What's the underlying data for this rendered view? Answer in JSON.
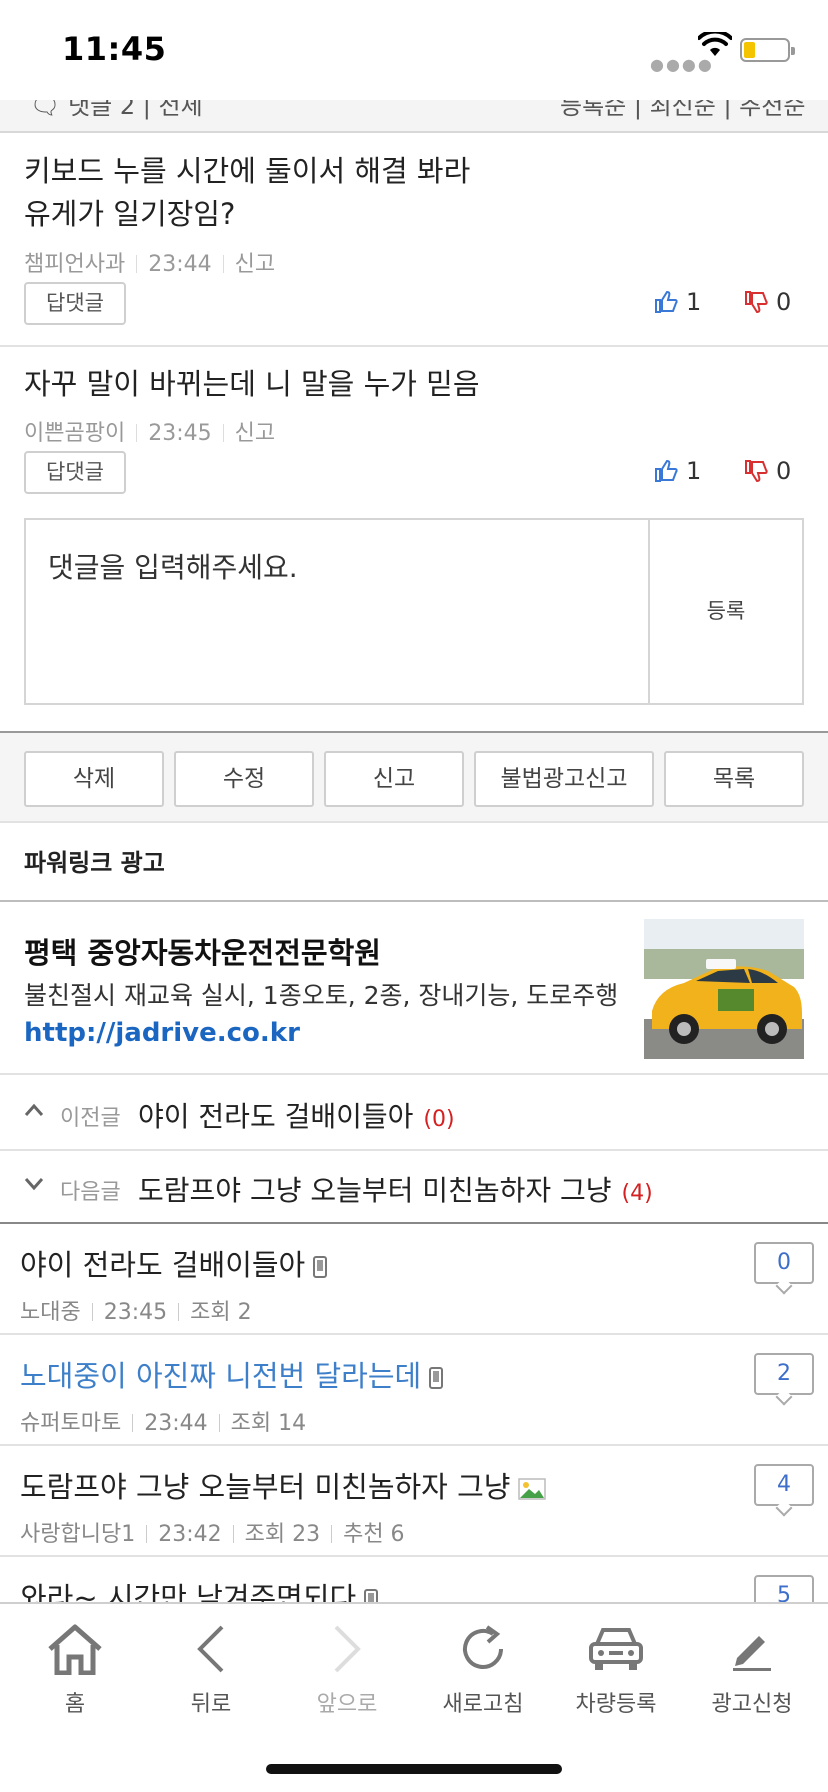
{
  "status_bar": {
    "time": "11:45"
  },
  "comments": [
    {
      "text_line1": "키보드 누를 시간에 둘이서 해결 봐라",
      "text_line2": "유게가 일기장임?",
      "author": "챔피언사과",
      "time": "23:44",
      "report": "신고",
      "reply_label": "답댓글",
      "likes": "1",
      "dislikes": "0"
    },
    {
      "text_line1": "자꾸 말이 바뀌는데 니 말을 누가 믿음",
      "author": "이쁜곰팡이",
      "time": "23:45",
      "report": "신고",
      "reply_label": "답댓글",
      "likes": "1",
      "dislikes": "0"
    }
  ],
  "comment_input": {
    "placeholder": "댓글을 입력해주세요.",
    "submit_label": "등록"
  },
  "actions": {
    "delete": "삭제",
    "edit": "수정",
    "report": "신고",
    "ad_report": "불법광고신고",
    "list": "목록"
  },
  "powerlink": {
    "heading": "파워링크 광고",
    "title": "평택 중앙자동차운전전문학원",
    "description": "불친절시 재교육 실시, 1종오토, 2종, 장내기능, 도로주행",
    "url": "http://jadrive.co.kr"
  },
  "prev_post": {
    "label": "이전글",
    "title": "야이 전라도 걸배이들아",
    "count": "(0)"
  },
  "next_post": {
    "label": "다음글",
    "title": "도람프야 그냥 오늘부터 미친놈하자 그냥",
    "count": "(4)"
  },
  "posts": [
    {
      "title": "야이 전라도 걸배이들아",
      "author": "노대중",
      "time": "23:45",
      "views": "조회 2",
      "comments": "0"
    },
    {
      "title": "노대중이 아진짜 니전번 달라는데",
      "author": "슈퍼토마토",
      "time": "23:44",
      "views": "조회 14",
      "comments": "2"
    },
    {
      "title": "도람프야 그냥 오늘부터 미친놈하자 그냥",
      "author": "사랑합니당1",
      "time": "23:42",
      "views": "조회 23",
      "recommend": "추천 6",
      "comments": "4"
    },
    {
      "title": "와라~ 시간만 남겨주면되다",
      "comments": "5"
    }
  ],
  "toolbar": {
    "home": "홈",
    "back": "뒤로",
    "forward": "앞으로",
    "refresh": "새로고침",
    "car": "차량등록",
    "ad": "광고신청"
  },
  "colors": {
    "link_blue": "#1a66c1",
    "title_blue": "#3d7fc9",
    "count_red": "#d42020",
    "like_blue": "#3a78d8",
    "dislike_red": "#d83030"
  }
}
